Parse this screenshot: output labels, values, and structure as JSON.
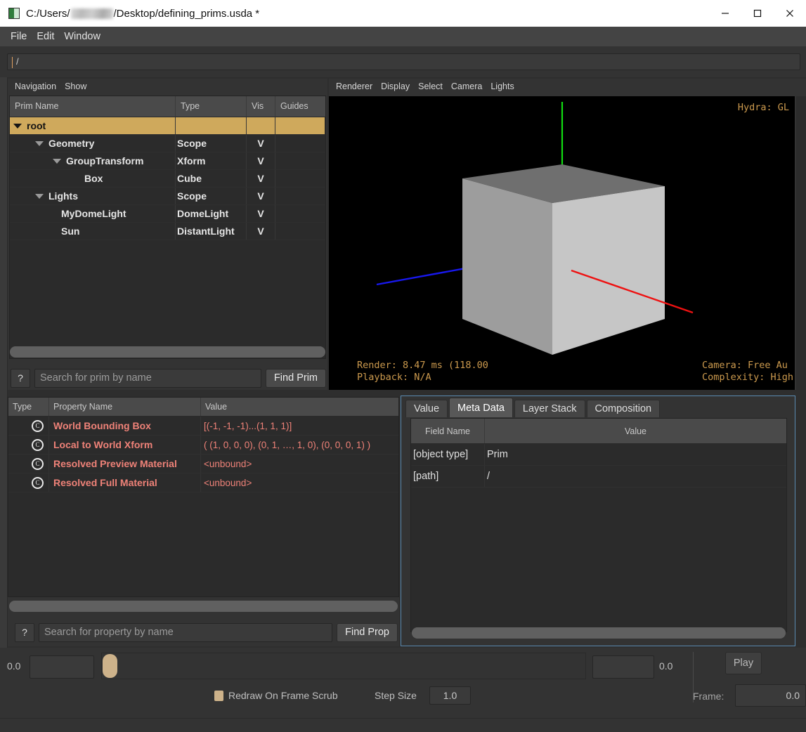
{
  "window": {
    "title_prefix": "C:/Users/",
    "title_suffix": "/Desktop/defining_prims.usda *",
    "app_icon": "usdview-icon",
    "minimize": "minimize-icon",
    "maximize": "maximize-icon",
    "close": "close-icon"
  },
  "menubar": {
    "items": [
      {
        "label": "File"
      },
      {
        "label": "Edit"
      },
      {
        "label": "Window"
      }
    ]
  },
  "pathbar": {
    "value": "/",
    "placeholder": ""
  },
  "tree_panel": {
    "menus": [
      {
        "label": "Navigation"
      },
      {
        "label": "Show"
      }
    ],
    "columns": [
      "Prim Name",
      "Type",
      "Vis",
      "Guides"
    ],
    "rows": [
      {
        "name": "root",
        "type": "",
        "vis": "",
        "guides": "",
        "indent": 0,
        "expander": "expanded",
        "selected": true
      },
      {
        "name": "Geometry",
        "type": "Scope",
        "vis": "V",
        "guides": "",
        "indent": 1,
        "expander": "expanded",
        "selected": false
      },
      {
        "name": "GroupTransform",
        "type": "Xform",
        "vis": "V",
        "guides": "",
        "indent": 2,
        "expander": "expanded",
        "selected": false
      },
      {
        "name": "Box",
        "type": "Cube",
        "vis": "V",
        "guides": "",
        "indent": 3,
        "expander": "none",
        "selected": false
      },
      {
        "name": "Lights",
        "type": "Scope",
        "vis": "V",
        "guides": "",
        "indent": 1,
        "expander": "expanded",
        "selected": false
      },
      {
        "name": "MyDomeLight",
        "type": "DomeLight",
        "vis": "V",
        "guides": "",
        "indent": 2,
        "expander": "none",
        "selected": false
      },
      {
        "name": "Sun",
        "type": "DistantLight",
        "vis": "V",
        "guides": "",
        "indent": 2,
        "expander": "none",
        "selected": false
      }
    ],
    "search": {
      "help_label": "?",
      "placeholder": "Search for prim by name",
      "value": "",
      "find_button": "Find Prim"
    },
    "selection_color": "#cfa95c"
  },
  "viewport": {
    "menus": [
      {
        "label": "Renderer"
      },
      {
        "label": "Display"
      },
      {
        "label": "Select"
      },
      {
        "label": "Camera"
      },
      {
        "label": "Lights"
      }
    ],
    "hud": {
      "top_right": "Hydra: GL",
      "render": "Render: 8.47 ms (118.00",
      "playback": "Playback: N/A",
      "camera": "Camera: Free Au",
      "complexity": "Complexity: High"
    },
    "hud_color": "#cc9a4e",
    "background_color": "#000000",
    "axis_colors": {
      "x": "#ee1111",
      "y": "#11dd11",
      "z": "#1818ee"
    },
    "object": "cube"
  },
  "property_panel": {
    "columns": [
      "Type",
      "Property Name",
      "Value"
    ],
    "rows": [
      {
        "icon": "computed-attribute-icon",
        "name": "World Bounding Box",
        "value": "[(-1, -1, -1)...(1, 1, 1)]"
      },
      {
        "icon": "computed-attribute-icon",
        "name": "Local to World Xform",
        "value": "( (1, 0, 0, 0), (0, 1, …, 1, 0), (0, 0, 0, 1) )"
      },
      {
        "icon": "computed-attribute-icon",
        "name": "Resolved Preview Material",
        "value": "<unbound>"
      },
      {
        "icon": "computed-attribute-icon",
        "name": "Resolved Full Material",
        "value": "<unbound>"
      }
    ],
    "search": {
      "help_label": "?",
      "placeholder": "Search for property by name",
      "value": "",
      "find_button": "Find Prop"
    },
    "name_color": "#ef8278"
  },
  "meta_panel": {
    "tabs": [
      {
        "label": "Value",
        "active": false
      },
      {
        "label": "Meta Data",
        "active": true
      },
      {
        "label": "Layer Stack",
        "active": false
      },
      {
        "label": "Composition",
        "active": false
      }
    ],
    "columns": [
      "Field Name",
      "Value"
    ],
    "rows": [
      {
        "field": "[object type]",
        "value": "Prim"
      },
      {
        "field": "[path]",
        "value": "/"
      }
    ],
    "focus_border_color": "#5a8ab0"
  },
  "timeline": {
    "start_label": "0.0",
    "start_value": "",
    "end_value": "",
    "end_label": "0.0",
    "redraw_label": "Redraw On Frame Scrub",
    "redraw_checked": true,
    "step_size_label": "Step Size",
    "step_size_value": "1.0",
    "play_button": "Play",
    "frame_label": "Frame:",
    "frame_value": "0.0"
  },
  "statusbar": {
    "text": ""
  }
}
